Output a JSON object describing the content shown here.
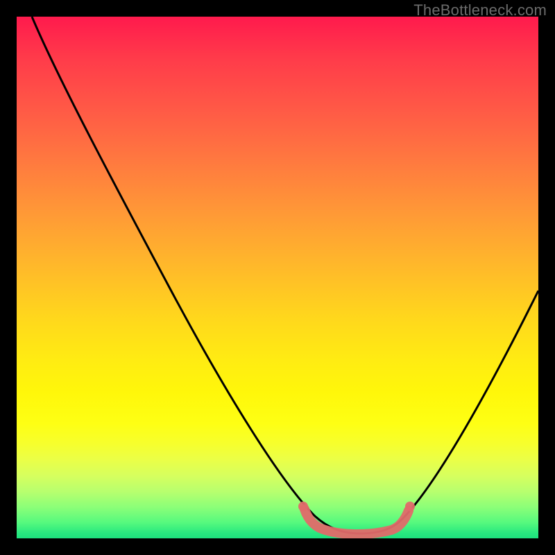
{
  "watermark": "TheBottleneck.com",
  "chart_data": {
    "type": "line",
    "title": "",
    "xlabel": "",
    "ylabel": "",
    "xlim": [
      0,
      100
    ],
    "ylim": [
      0,
      100
    ],
    "grid": false,
    "legend": false,
    "series": [
      {
        "name": "bottleneck-curve",
        "x": [
          3,
          10,
          20,
          30,
          40,
          50,
          55,
          58,
          60,
          63,
          66,
          70,
          75,
          80,
          85,
          90,
          95,
          100
        ],
        "y": [
          100,
          87,
          71,
          54,
          38,
          21,
          12,
          6,
          3,
          2,
          2,
          2,
          4,
          10,
          19,
          29,
          40,
          52
        ],
        "color": "#000000"
      },
      {
        "name": "optimal-range-band",
        "x": [
          55,
          58,
          61,
          64,
          67,
          71,
          74
        ],
        "y": [
          5,
          2.5,
          1.8,
          1.6,
          1.6,
          2.2,
          4.5
        ],
        "color": "#e06a6a"
      }
    ],
    "background_gradient": {
      "top": "#ff1a4d",
      "mid": "#ffe012",
      "bottom": "#1ee07e"
    }
  }
}
